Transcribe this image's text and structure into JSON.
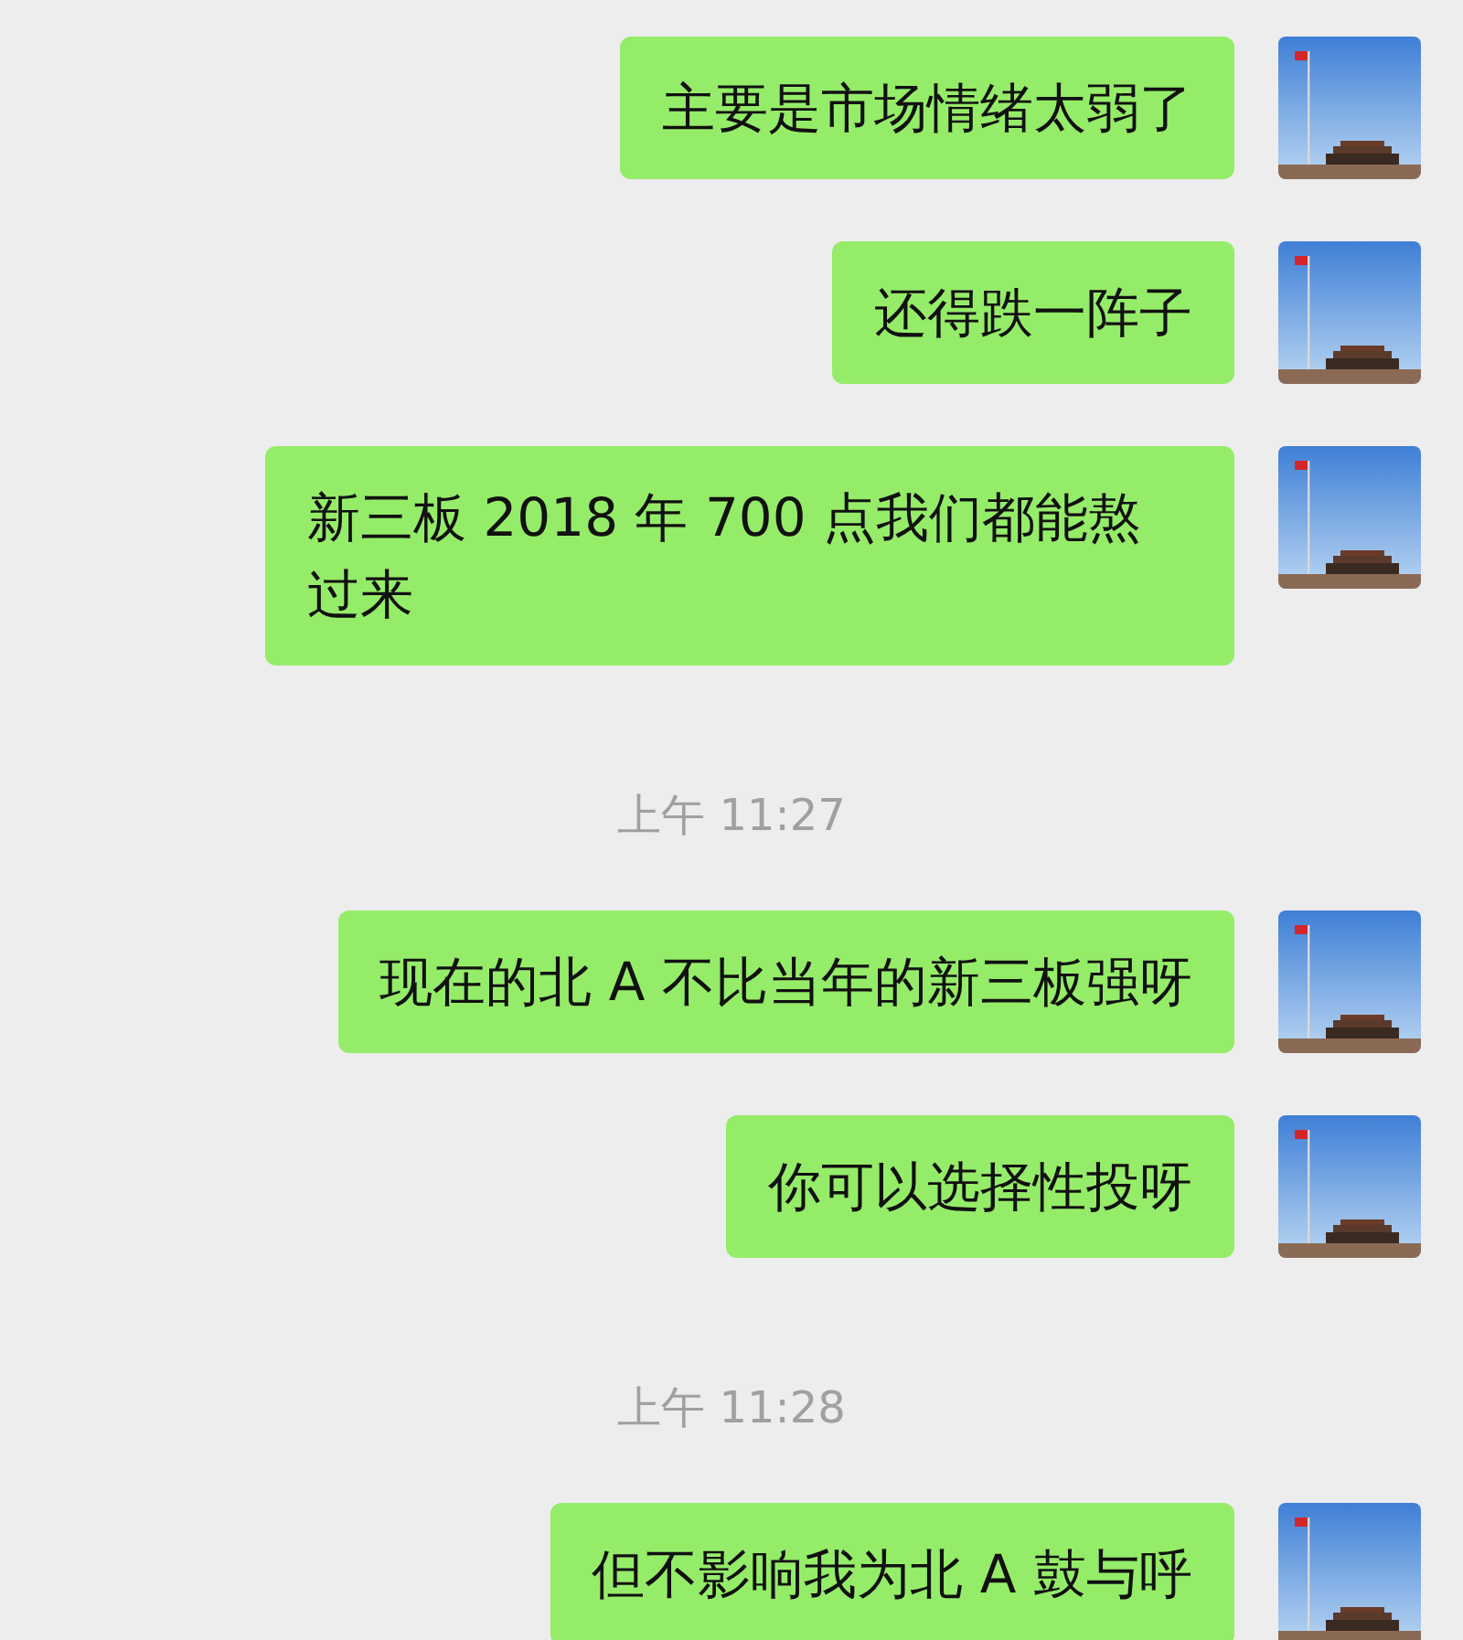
{
  "messages": [
    {
      "kind": "message",
      "text": "主要是市场情绪太弱了"
    },
    {
      "kind": "message",
      "text": "还得跌一阵子"
    },
    {
      "kind": "message",
      "text": "新三板 2018 年 700 点我们都能熬过来"
    },
    {
      "kind": "time",
      "text": "上午 11:27"
    },
    {
      "kind": "message",
      "text": "现在的北 A 不比当年的新三板强呀"
    },
    {
      "kind": "message",
      "text": "你可以选择性投呀"
    },
    {
      "kind": "time",
      "text": "上午 11:28"
    },
    {
      "kind": "message",
      "text": "但不影响我为北 A 鼓与呼"
    }
  ]
}
